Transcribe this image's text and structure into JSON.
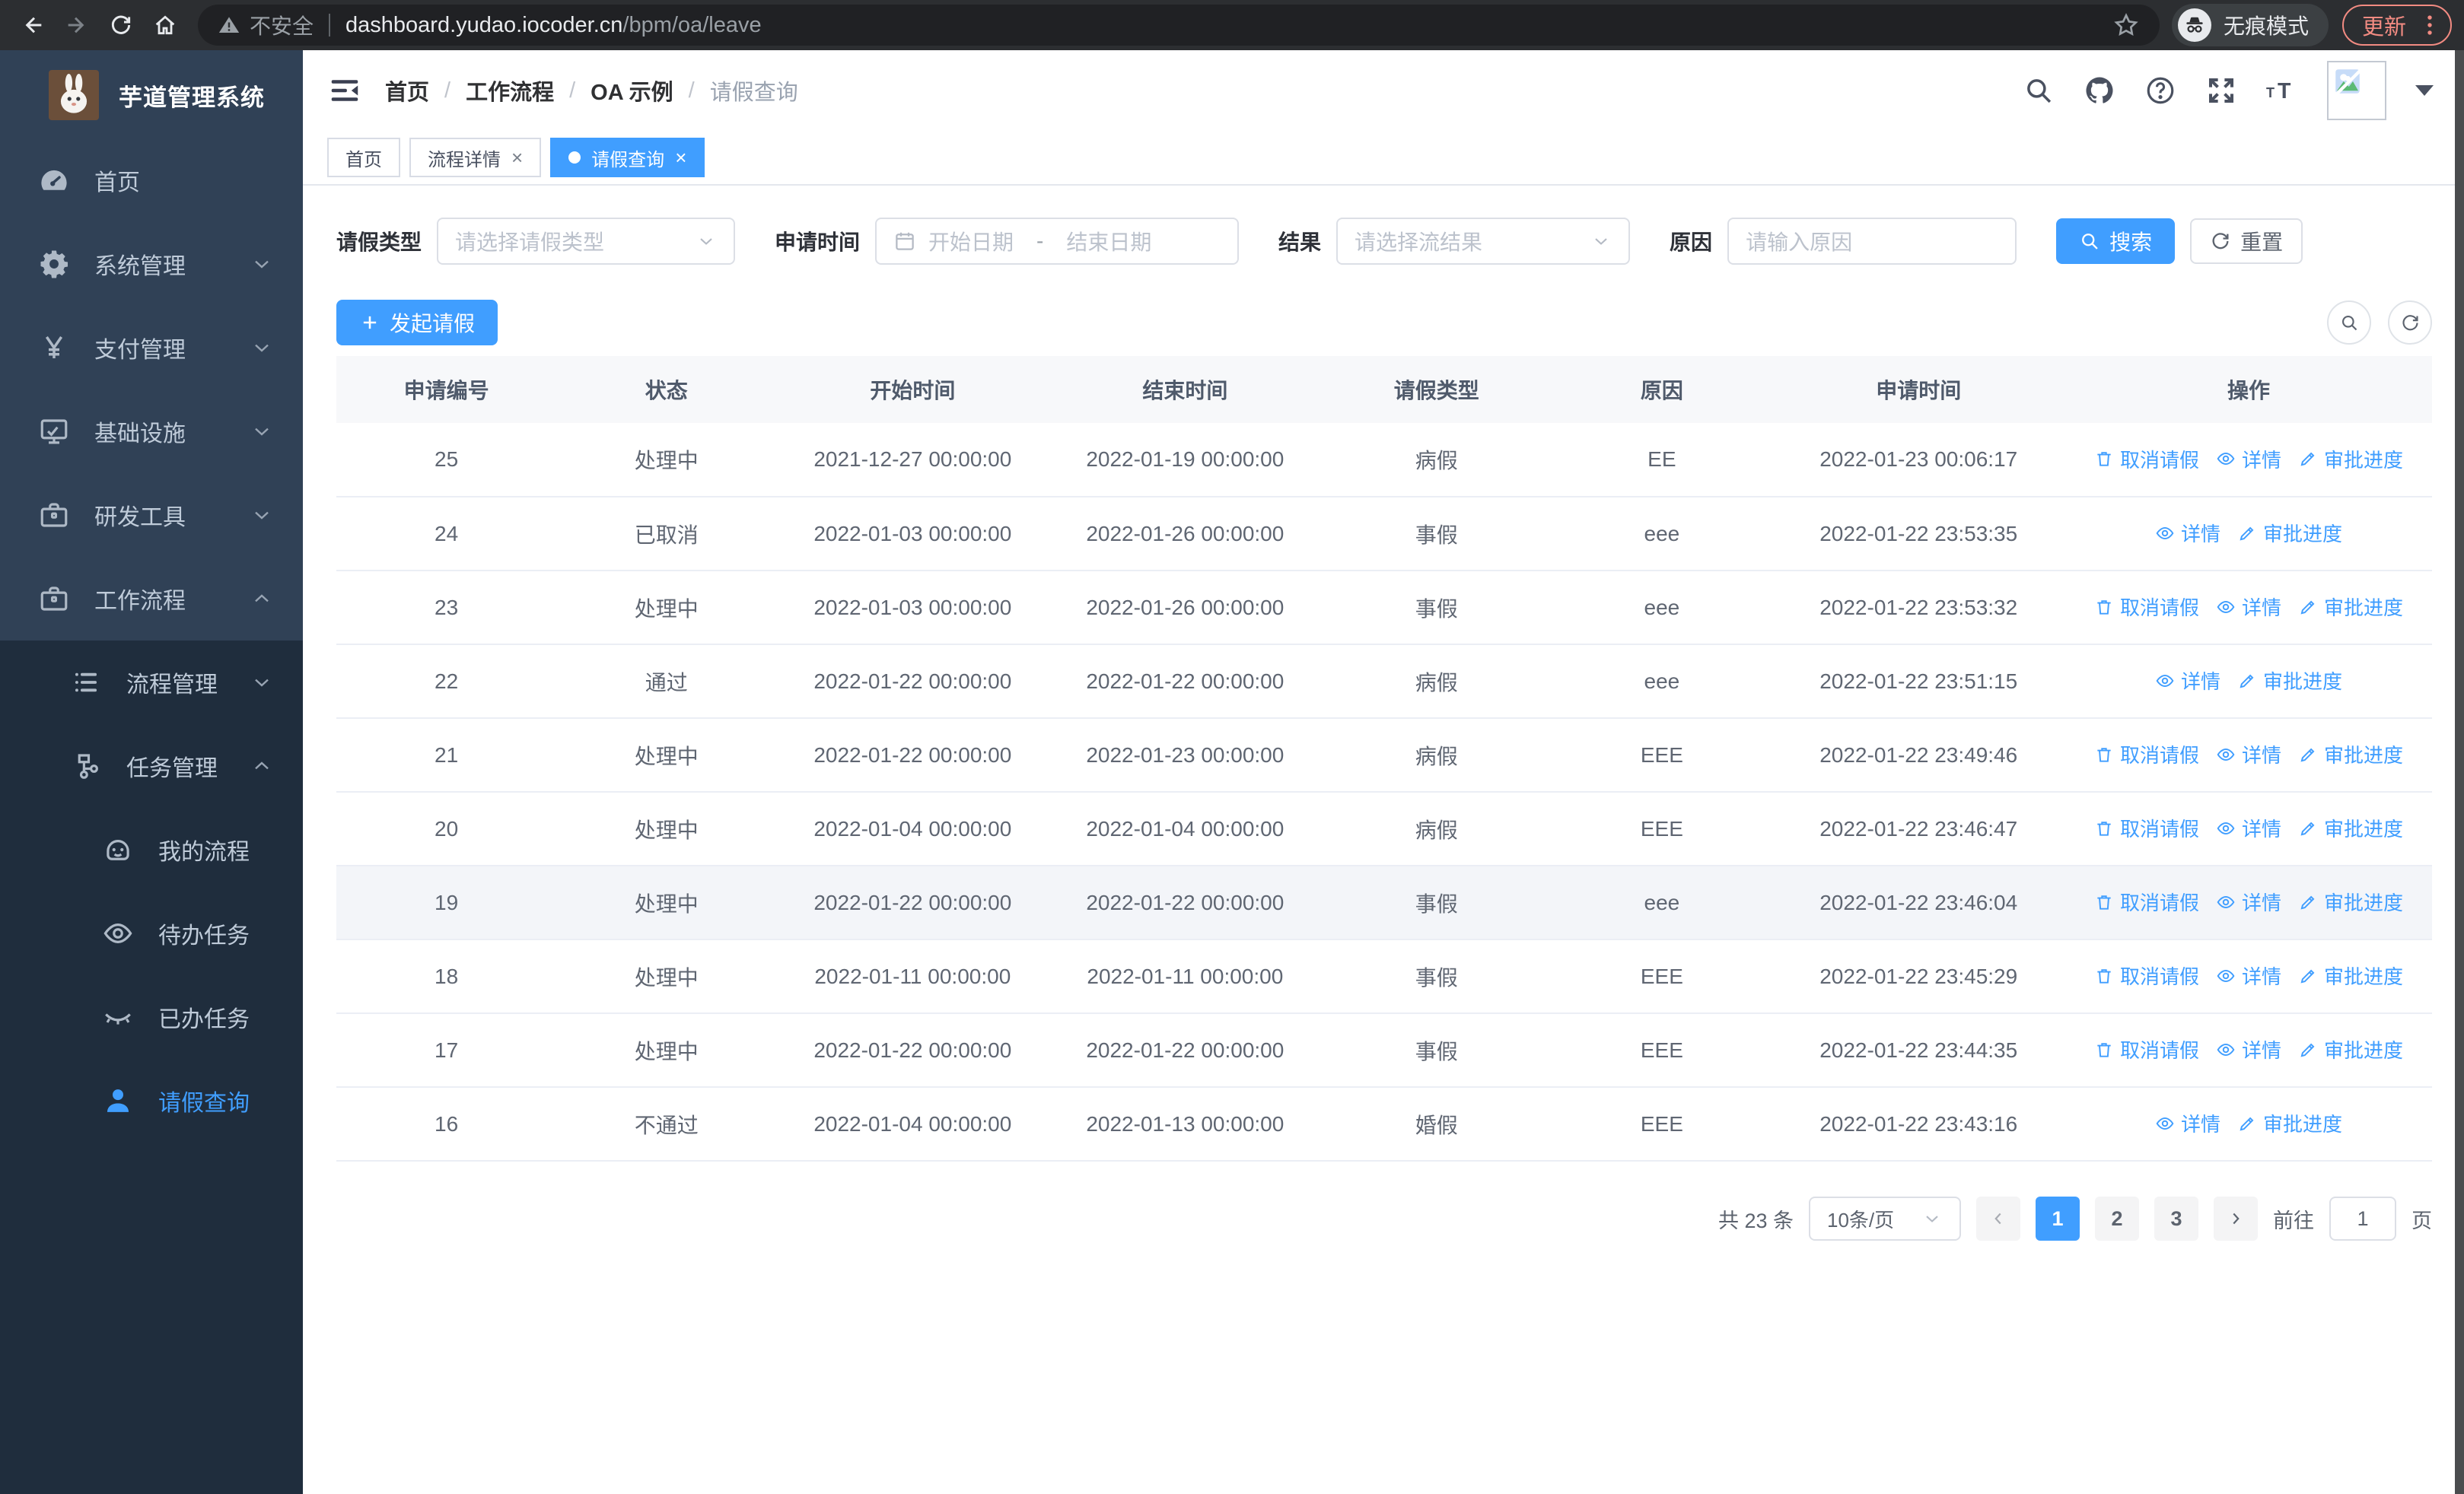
{
  "browser": {
    "not_secure_label": "不安全",
    "url_host": "dashboard.yudao.iocoder.cn",
    "url_path": "/bpm/oa/leave",
    "incognito_label": "无痕模式",
    "update_label": "更新"
  },
  "sidebar": {
    "title": "芋道管理系统",
    "items": [
      {
        "key": "home",
        "label": "首页",
        "icon": "dashboard-icon",
        "depth": 1
      },
      {
        "key": "system",
        "label": "系统管理",
        "icon": "gear-icon",
        "depth": 1,
        "chevron": "down"
      },
      {
        "key": "payment",
        "label": "支付管理",
        "icon": "yen-icon",
        "depth": 1,
        "chevron": "down"
      },
      {
        "key": "infrastructure",
        "label": "基础设施",
        "icon": "monitor-icon",
        "depth": 1,
        "chevron": "down"
      },
      {
        "key": "dev-tools",
        "label": "研发工具",
        "icon": "briefcase-icon",
        "depth": 1,
        "chevron": "down"
      },
      {
        "key": "workflow",
        "label": "工作流程",
        "icon": "briefcase-icon",
        "depth": 1,
        "chevron": "up",
        "children": [
          {
            "key": "process-management",
            "label": "流程管理",
            "icon": "list-icon",
            "depth": 2,
            "chevron": "down"
          },
          {
            "key": "task-management",
            "label": "任务管理",
            "icon": "sitemap-icon",
            "depth": 2,
            "chevron": "up",
            "children": [
              {
                "key": "my-process",
                "label": "我的流程",
                "icon": "robot-icon",
                "depth": 3
              },
              {
                "key": "todo-tasks",
                "label": "待办任务",
                "icon": "eye-icon",
                "depth": 3
              },
              {
                "key": "done-tasks",
                "label": "已办任务",
                "icon": "eye-closed-icon",
                "depth": 3
              },
              {
                "key": "leave-query",
                "label": "请假查询",
                "icon": "user-icon",
                "depth": 3,
                "active": true
              }
            ]
          }
        ]
      }
    ]
  },
  "breadcrumb": {
    "items": [
      "首页",
      "工作流程",
      "OA 示例",
      "请假查询"
    ]
  },
  "tabs": [
    {
      "key": "home",
      "label": "首页",
      "closable": false,
      "active": false
    },
    {
      "key": "process-detail",
      "label": "流程详情",
      "closable": true,
      "active": false
    },
    {
      "key": "leave-query",
      "label": "请假查询",
      "closable": true,
      "active": true
    }
  ],
  "filters": {
    "type_label": "请假类型",
    "type_placeholder": "请选择请假类型",
    "time_label": "申请时间",
    "start_placeholder": "开始日期",
    "range_separator": "-",
    "end_placeholder": "结束日期",
    "result_label": "结果",
    "result_placeholder": "请选择流结果",
    "reason_label": "原因",
    "reason_placeholder": "请输入原因",
    "search_label": "搜索",
    "reset_label": "重置"
  },
  "toolbar": {
    "create_label": "发起请假"
  },
  "table": {
    "columns": [
      "申请编号",
      "状态",
      "开始时间",
      "结束时间",
      "请假类型",
      "原因",
      "申请时间",
      "操作"
    ],
    "action_labels": {
      "cancel": "取消请假",
      "detail": "详情",
      "progress": "审批进度"
    },
    "action_icons": {
      "cancel": "trash-icon",
      "detail": "eye-icon",
      "progress": "pencil-icon"
    },
    "rows": [
      {
        "id": "25",
        "status": "处理中",
        "start": "2021-12-27 00:00:00",
        "end": "2022-01-19 00:00:00",
        "type": "病假",
        "reason": "EE",
        "apply_time": "2022-01-23 00:06:17",
        "actions": [
          "cancel",
          "detail",
          "progress"
        ]
      },
      {
        "id": "24",
        "status": "已取消",
        "start": "2022-01-03 00:00:00",
        "end": "2022-01-26 00:00:00",
        "type": "事假",
        "reason": "eee",
        "apply_time": "2022-01-22 23:53:35",
        "actions": [
          "detail",
          "progress"
        ]
      },
      {
        "id": "23",
        "status": "处理中",
        "start": "2022-01-03 00:00:00",
        "end": "2022-01-26 00:00:00",
        "type": "事假",
        "reason": "eee",
        "apply_time": "2022-01-22 23:53:32",
        "actions": [
          "cancel",
          "detail",
          "progress"
        ]
      },
      {
        "id": "22",
        "status": "通过",
        "start": "2022-01-22 00:00:00",
        "end": "2022-01-22 00:00:00",
        "type": "病假",
        "reason": "eee",
        "apply_time": "2022-01-22 23:51:15",
        "actions": [
          "detail",
          "progress"
        ]
      },
      {
        "id": "21",
        "status": "处理中",
        "start": "2022-01-22 00:00:00",
        "end": "2022-01-23 00:00:00",
        "type": "病假",
        "reason": "EEE",
        "apply_time": "2022-01-22 23:49:46",
        "actions": [
          "cancel",
          "detail",
          "progress"
        ]
      },
      {
        "id": "20",
        "status": "处理中",
        "start": "2022-01-04 00:00:00",
        "end": "2022-01-04 00:00:00",
        "type": "病假",
        "reason": "EEE",
        "apply_time": "2022-01-22 23:46:47",
        "actions": [
          "cancel",
          "detail",
          "progress"
        ]
      },
      {
        "id": "19",
        "status": "处理中",
        "start": "2022-01-22 00:00:00",
        "end": "2022-01-22 00:00:00",
        "type": "事假",
        "reason": "eee",
        "apply_time": "2022-01-22 23:46:04",
        "actions": [
          "cancel",
          "detail",
          "progress"
        ],
        "highlighted": true
      },
      {
        "id": "18",
        "status": "处理中",
        "start": "2022-01-11 00:00:00",
        "end": "2022-01-11 00:00:00",
        "type": "事假",
        "reason": "EEE",
        "apply_time": "2022-01-22 23:45:29",
        "actions": [
          "cancel",
          "detail",
          "progress"
        ]
      },
      {
        "id": "17",
        "status": "处理中",
        "start": "2022-01-22 00:00:00",
        "end": "2022-01-22 00:00:00",
        "type": "事假",
        "reason": "EEE",
        "apply_time": "2022-01-22 23:44:35",
        "actions": [
          "cancel",
          "detail",
          "progress"
        ]
      },
      {
        "id": "16",
        "status": "不通过",
        "start": "2022-01-04 00:00:00",
        "end": "2022-01-13 00:00:00",
        "type": "婚假",
        "reason": "EEE",
        "apply_time": "2022-01-22 23:43:16",
        "actions": [
          "detail",
          "progress"
        ]
      }
    ]
  },
  "pagination": {
    "total_text": "共 23 条",
    "page_size_label": "10条/页",
    "pages": [
      "1",
      "2",
      "3"
    ],
    "active_page": "1",
    "goto_label": "前往",
    "goto_value": "1",
    "page_suffix": "页"
  },
  "colors": {
    "accent_blue": "#409eff",
    "sidebar_bg": "#304156",
    "submenu_bg": "#1f2d3d",
    "chrome_update_red": "#f28b82",
    "table_header_bg": "#f7f8fa"
  },
  "icons": {
    "warning-icon": "triangle-exclamation",
    "search-icon": "magnifier",
    "github-icon": "octocat",
    "help-icon": "question-circle",
    "fullscreen-icon": "expand-arrows",
    "font-size-icon": "double-T",
    "incognito-icon": "hat-and-glasses",
    "trash-icon": "trash-bin",
    "eye-icon": "eye",
    "pencil-icon": "pencil",
    "calendar-icon": "calendar",
    "refresh-icon": "circular-arrow",
    "plus-icon": "plus"
  }
}
